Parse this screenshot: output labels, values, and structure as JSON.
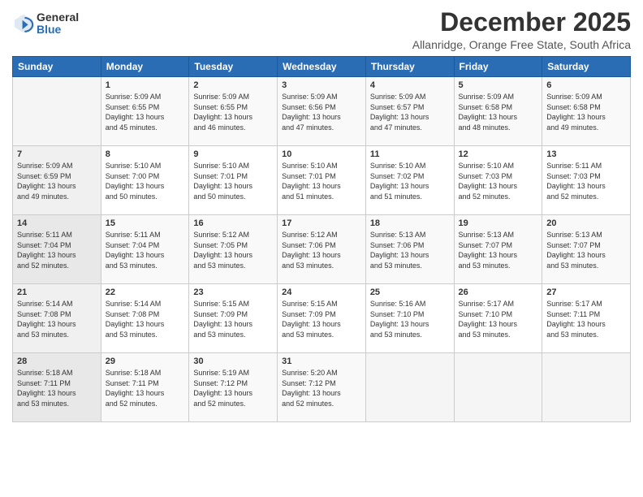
{
  "header": {
    "logo_general": "General",
    "logo_blue": "Blue",
    "month_title": "December 2025",
    "subtitle": "Allanridge, Orange Free State, South Africa"
  },
  "weekdays": [
    "Sunday",
    "Monday",
    "Tuesday",
    "Wednesday",
    "Thursday",
    "Friday",
    "Saturday"
  ],
  "weeks": [
    [
      {
        "day": "",
        "info": ""
      },
      {
        "day": "1",
        "info": "Sunrise: 5:09 AM\nSunset: 6:55 PM\nDaylight: 13 hours\nand 45 minutes."
      },
      {
        "day": "2",
        "info": "Sunrise: 5:09 AM\nSunset: 6:55 PM\nDaylight: 13 hours\nand 46 minutes."
      },
      {
        "day": "3",
        "info": "Sunrise: 5:09 AM\nSunset: 6:56 PM\nDaylight: 13 hours\nand 47 minutes."
      },
      {
        "day": "4",
        "info": "Sunrise: 5:09 AM\nSunset: 6:57 PM\nDaylight: 13 hours\nand 47 minutes."
      },
      {
        "day": "5",
        "info": "Sunrise: 5:09 AM\nSunset: 6:58 PM\nDaylight: 13 hours\nand 48 minutes."
      },
      {
        "day": "6",
        "info": "Sunrise: 5:09 AM\nSunset: 6:58 PM\nDaylight: 13 hours\nand 49 minutes."
      }
    ],
    [
      {
        "day": "7",
        "info": "Sunrise: 5:09 AM\nSunset: 6:59 PM\nDaylight: 13 hours\nand 49 minutes."
      },
      {
        "day": "8",
        "info": "Sunrise: 5:10 AM\nSunset: 7:00 PM\nDaylight: 13 hours\nand 50 minutes."
      },
      {
        "day": "9",
        "info": "Sunrise: 5:10 AM\nSunset: 7:01 PM\nDaylight: 13 hours\nand 50 minutes."
      },
      {
        "day": "10",
        "info": "Sunrise: 5:10 AM\nSunset: 7:01 PM\nDaylight: 13 hours\nand 51 minutes."
      },
      {
        "day": "11",
        "info": "Sunrise: 5:10 AM\nSunset: 7:02 PM\nDaylight: 13 hours\nand 51 minutes."
      },
      {
        "day": "12",
        "info": "Sunrise: 5:10 AM\nSunset: 7:03 PM\nDaylight: 13 hours\nand 52 minutes."
      },
      {
        "day": "13",
        "info": "Sunrise: 5:11 AM\nSunset: 7:03 PM\nDaylight: 13 hours\nand 52 minutes."
      }
    ],
    [
      {
        "day": "14",
        "info": "Sunrise: 5:11 AM\nSunset: 7:04 PM\nDaylight: 13 hours\nand 52 minutes."
      },
      {
        "day": "15",
        "info": "Sunrise: 5:11 AM\nSunset: 7:04 PM\nDaylight: 13 hours\nand 53 minutes."
      },
      {
        "day": "16",
        "info": "Sunrise: 5:12 AM\nSunset: 7:05 PM\nDaylight: 13 hours\nand 53 minutes."
      },
      {
        "day": "17",
        "info": "Sunrise: 5:12 AM\nSunset: 7:06 PM\nDaylight: 13 hours\nand 53 minutes."
      },
      {
        "day": "18",
        "info": "Sunrise: 5:13 AM\nSunset: 7:06 PM\nDaylight: 13 hours\nand 53 minutes."
      },
      {
        "day": "19",
        "info": "Sunrise: 5:13 AM\nSunset: 7:07 PM\nDaylight: 13 hours\nand 53 minutes."
      },
      {
        "day": "20",
        "info": "Sunrise: 5:13 AM\nSunset: 7:07 PM\nDaylight: 13 hours\nand 53 minutes."
      }
    ],
    [
      {
        "day": "21",
        "info": "Sunrise: 5:14 AM\nSunset: 7:08 PM\nDaylight: 13 hours\nand 53 minutes."
      },
      {
        "day": "22",
        "info": "Sunrise: 5:14 AM\nSunset: 7:08 PM\nDaylight: 13 hours\nand 53 minutes."
      },
      {
        "day": "23",
        "info": "Sunrise: 5:15 AM\nSunset: 7:09 PM\nDaylight: 13 hours\nand 53 minutes."
      },
      {
        "day": "24",
        "info": "Sunrise: 5:15 AM\nSunset: 7:09 PM\nDaylight: 13 hours\nand 53 minutes."
      },
      {
        "day": "25",
        "info": "Sunrise: 5:16 AM\nSunset: 7:10 PM\nDaylight: 13 hours\nand 53 minutes."
      },
      {
        "day": "26",
        "info": "Sunrise: 5:17 AM\nSunset: 7:10 PM\nDaylight: 13 hours\nand 53 minutes."
      },
      {
        "day": "27",
        "info": "Sunrise: 5:17 AM\nSunset: 7:11 PM\nDaylight: 13 hours\nand 53 minutes."
      }
    ],
    [
      {
        "day": "28",
        "info": "Sunrise: 5:18 AM\nSunset: 7:11 PM\nDaylight: 13 hours\nand 53 minutes."
      },
      {
        "day": "29",
        "info": "Sunrise: 5:18 AM\nSunset: 7:11 PM\nDaylight: 13 hours\nand 52 minutes."
      },
      {
        "day": "30",
        "info": "Sunrise: 5:19 AM\nSunset: 7:12 PM\nDaylight: 13 hours\nand 52 minutes."
      },
      {
        "day": "31",
        "info": "Sunrise: 5:20 AM\nSunset: 7:12 PM\nDaylight: 13 hours\nand 52 minutes."
      },
      {
        "day": "",
        "info": ""
      },
      {
        "day": "",
        "info": ""
      },
      {
        "day": "",
        "info": ""
      }
    ]
  ]
}
